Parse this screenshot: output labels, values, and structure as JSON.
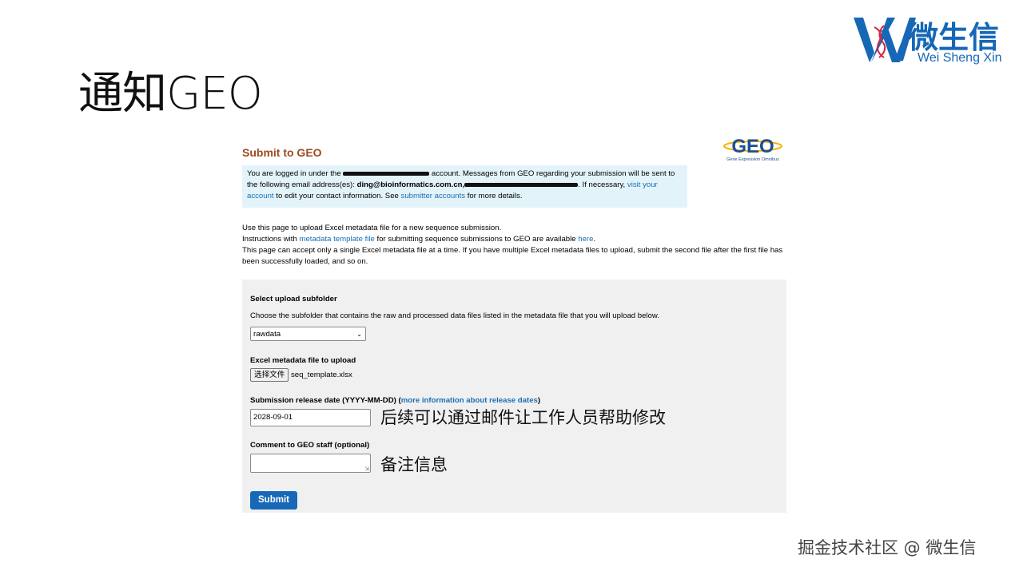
{
  "slide": {
    "title": "通知GEO",
    "annotation_release": "后续可以通过邮件让工作人员帮助修改",
    "annotation_comment": "备注信息",
    "footer": "掘金技术社区 @ 微生信"
  },
  "brand": {
    "name_cn": "微生信",
    "name_en": "Wei Sheng Xin",
    "color": "#1668b6"
  },
  "geo": {
    "heading": "Submit to GEO",
    "logo_text": "GEO",
    "logo_caption": "Gene Expression Omnibus",
    "login": {
      "part1": "You are logged in under the",
      "part2": "account. Messages from GEO regarding your submission will be sent to the following email address(es):",
      "email": "ding@bioinformatics.com.cn,",
      "part3": ". If necessary,",
      "visit_link": "visit your account",
      "part4": "to edit your contact information. See",
      "submitter_link": "submitter accounts",
      "part5": "for more details."
    },
    "intro": {
      "line1": "Use this page to upload Excel metadata file for a new sequence submission.",
      "line2_a": "Instructions with",
      "metadata_link": "metadata template file",
      "line2_b": "for submitting sequence submissions to GEO are available",
      "here_link": "here",
      "line2_c": ".",
      "line3": "This page can accept only a single Excel metadata file at a time. If you have multiple Excel metadata files to upload, submit the second file after the first file has been successfully loaded, and so on."
    },
    "form": {
      "subfolder_label": "Select upload subfolder",
      "subfolder_help": "Choose the subfolder that contains the raw and processed data files listed in the metadata file that you will upload below.",
      "subfolder_value": "rawdata",
      "metadata_label": "Excel metadata file to upload",
      "choose_file_button": "选择文件",
      "file_name": "seq_template.xlsx",
      "release_label": "Submission release date (YYYY-MM-DD)",
      "release_open": "(",
      "release_link": "more information about release dates",
      "release_close": ")",
      "release_value": "2028-09-01",
      "comment_label": "Comment to GEO staff (optional)",
      "comment_value": "",
      "submit_label": "Submit"
    }
  }
}
